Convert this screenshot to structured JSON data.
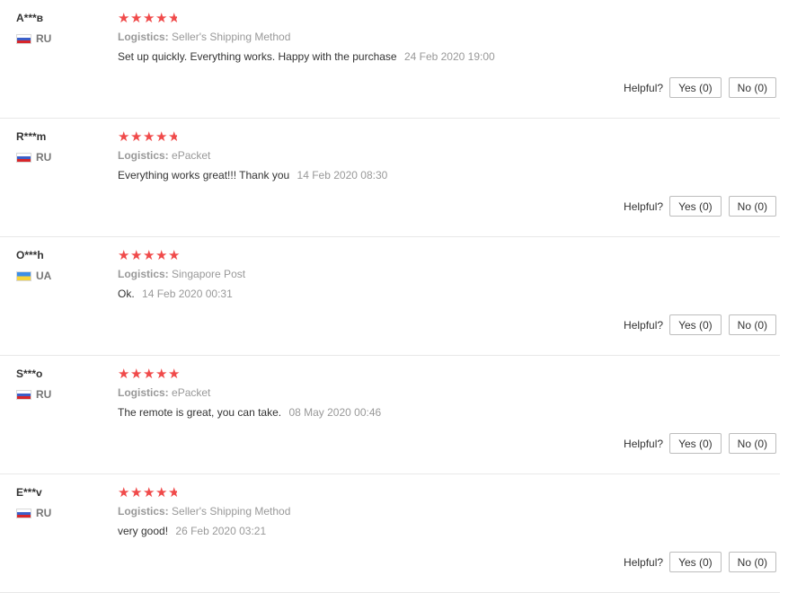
{
  "reviews": [
    {
      "user": "A***в",
      "country": "RU",
      "rating": 4.5,
      "logistics_label": "Logistics:",
      "logistics": "Seller's Shipping Method",
      "text": "Set up quickly. Everything works. Happy with the purchase",
      "date": "24 Feb 2020 19:00",
      "helpful_label": "Helpful?",
      "yes_label": "Yes (0)",
      "no_label": "No (0)"
    },
    {
      "user": "R***m",
      "country": "RU",
      "rating": 4.5,
      "logistics_label": "Logistics:",
      "logistics": "ePacket",
      "text": "Everything works great!!! Thank you",
      "date": "14 Feb 2020 08:30",
      "helpful_label": "Helpful?",
      "yes_label": "Yes (0)",
      "no_label": "No (0)"
    },
    {
      "user": "O***h",
      "country": "UA",
      "rating": 5,
      "logistics_label": "Logistics:",
      "logistics": "Singapore Post",
      "text": "Ok.",
      "date": "14 Feb 2020 00:31",
      "helpful_label": "Helpful?",
      "yes_label": "Yes (0)",
      "no_label": "No (0)"
    },
    {
      "user": "S***o",
      "country": "RU",
      "rating": 5,
      "logistics_label": "Logistics:",
      "logistics": "ePacket",
      "text": "The remote is great, you can take.",
      "date": "08 May 2020 00:46",
      "helpful_label": "Helpful?",
      "yes_label": "Yes (0)",
      "no_label": "No (0)"
    },
    {
      "user": "E***v",
      "country": "RU",
      "rating": 4.5,
      "logistics_label": "Logistics:",
      "logistics": "Seller's Shipping Method",
      "text": "very good!",
      "date": "26 Feb 2020 03:21",
      "helpful_label": "Helpful?",
      "yes_label": "Yes (0)",
      "no_label": "No (0)"
    }
  ],
  "colors": {
    "star": "#f04a4a",
    "muted": "#999999",
    "text": "#333333"
  },
  "icons": {
    "star": "star-icon",
    "flag_ru": "flag-ru-icon",
    "flag_ua": "flag-ua-icon"
  }
}
